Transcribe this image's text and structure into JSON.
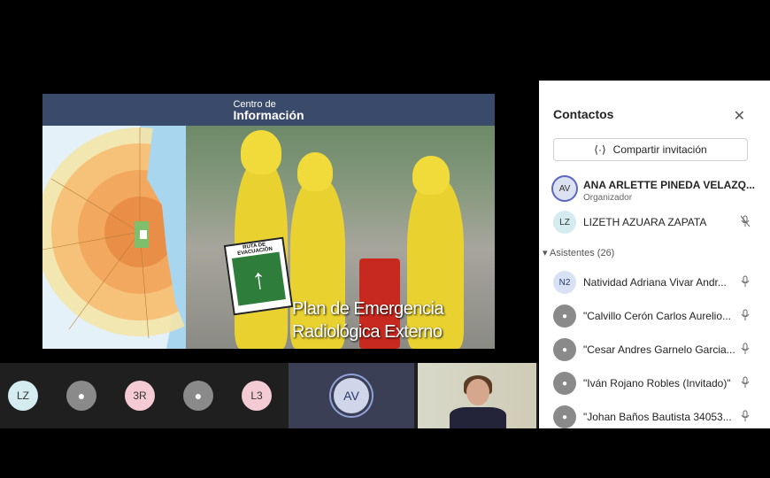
{
  "slide": {
    "logo_line1": "Centro de",
    "logo_line2": "Información",
    "caption_line1": "Plan de Emergencia",
    "caption_line2": "Radiológica Externo",
    "sign_caption": "RUTA DE EVACUACIÓN",
    "sign_arrow": "↑"
  },
  "video_strip": {
    "tiles": [
      {
        "initials": "LZ"
      },
      {
        "initials": ""
      },
      {
        "initials": "3R"
      },
      {
        "initials": ""
      },
      {
        "initials": "L3"
      }
    ],
    "active_speaker": "AV"
  },
  "contacts": {
    "title": "Contactos",
    "close_icon": "✕",
    "share_label": "Compartir invitación",
    "organizers": [
      {
        "initials": "AV",
        "name": "ANA ARLETTE PINEDA VELAZQ...",
        "role": "Organizador"
      },
      {
        "initials": "LZ",
        "name": "LIZETH AZUARA ZAPATA",
        "mic": "mic-off-icon"
      }
    ],
    "attendees_header": "Asistentes (26)",
    "attendees": [
      {
        "initials": "N2",
        "name": "Natividad Adriana Vivar Andr..."
      },
      {
        "initials": "",
        "name": "\"Calvillo Cerón Carlos Aurelio..."
      },
      {
        "initials": "",
        "name": "\"Cesar Andres Garnelo Garcia..."
      },
      {
        "initials": "",
        "name": "\"Iván Rojano Robles (Invitado)\""
      },
      {
        "initials": "",
        "name": "\"Johan Baños Bautista 34053..."
      }
    ]
  }
}
